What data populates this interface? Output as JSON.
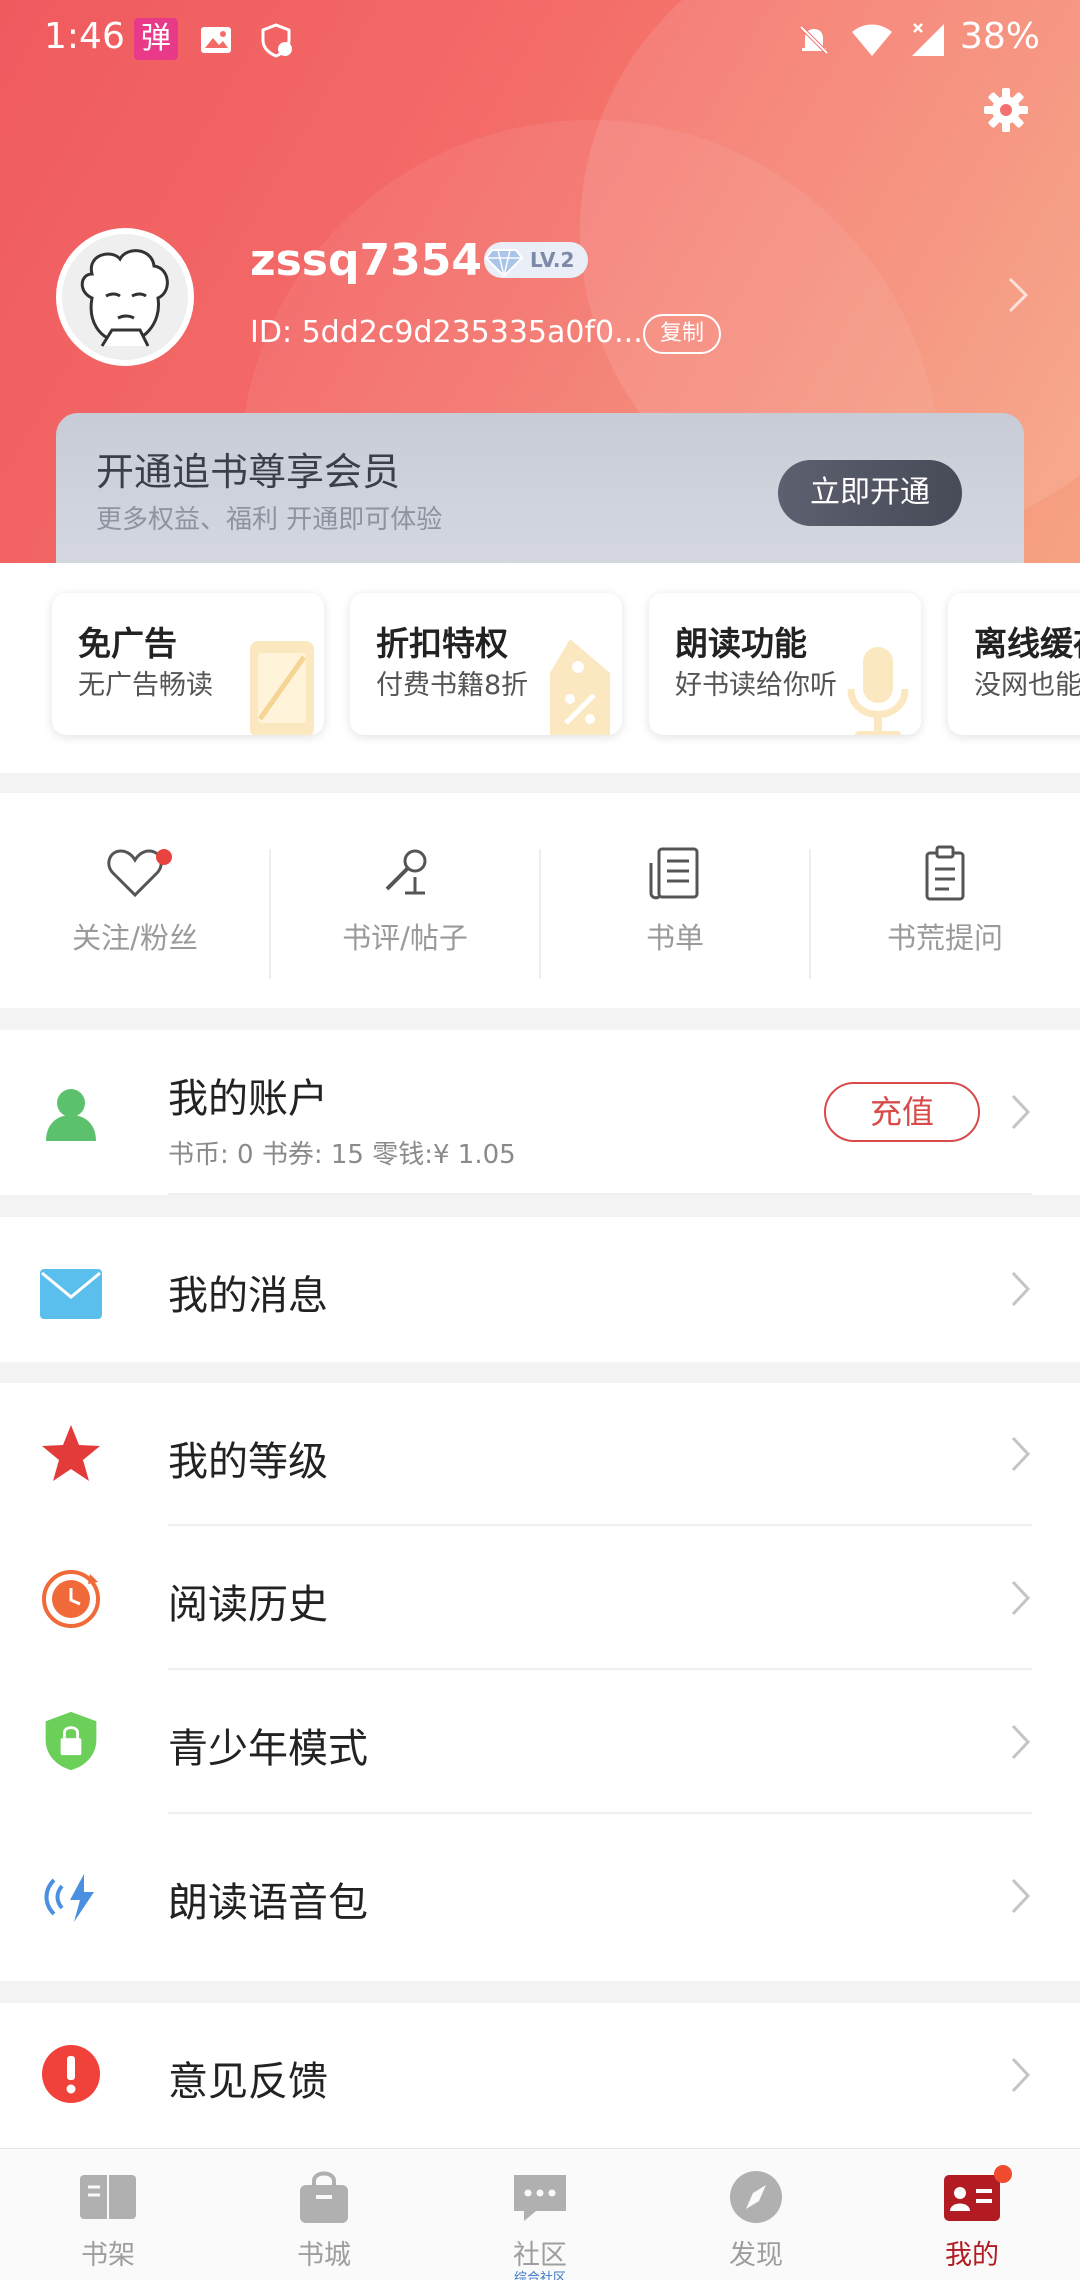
{
  "status": {
    "time": "1:46",
    "battery": "38%",
    "app_badge": "弹"
  },
  "profile": {
    "username": "zssq7354",
    "level": "LV.2",
    "user_id": "ID: 5dd2c9d235335a0f0...",
    "copy_label": "复制"
  },
  "vip": {
    "title": "开通追书尊享会员",
    "subtitle": "更多权益、福利 开通即可体验",
    "button": "立即开通"
  },
  "privileges": [
    {
      "title": "免广告",
      "desc": "无广告畅读"
    },
    {
      "title": "折扣特权",
      "desc": "付费书籍8折"
    },
    {
      "title": "朗读功能",
      "desc": "好书读给你听"
    },
    {
      "title": "离线缓存",
      "desc": "没网也能"
    }
  ],
  "quick": [
    {
      "label": "关注/粉丝"
    },
    {
      "label": "书评/帖子"
    },
    {
      "label": "书单"
    },
    {
      "label": "书荒提问"
    }
  ],
  "account": {
    "title": "我的账户",
    "detail": "书币: 0 书券: 15 零钱:¥ 1.05",
    "recharge": "充值"
  },
  "menu": {
    "messages": "我的消息",
    "level": "我的等级",
    "history": "阅读历史",
    "youth": "青少年模式",
    "voice": "朗读语音包",
    "feedback": "意见反馈"
  },
  "nav": [
    {
      "label": "书架"
    },
    {
      "label": "书城"
    },
    {
      "label": "社区",
      "sub": "综合社区"
    },
    {
      "label": "发现"
    },
    {
      "label": "我的"
    }
  ],
  "colors": {
    "header": "#ef5a5f",
    "accent": "#b11b21",
    "recharge": "#d94a4a"
  }
}
